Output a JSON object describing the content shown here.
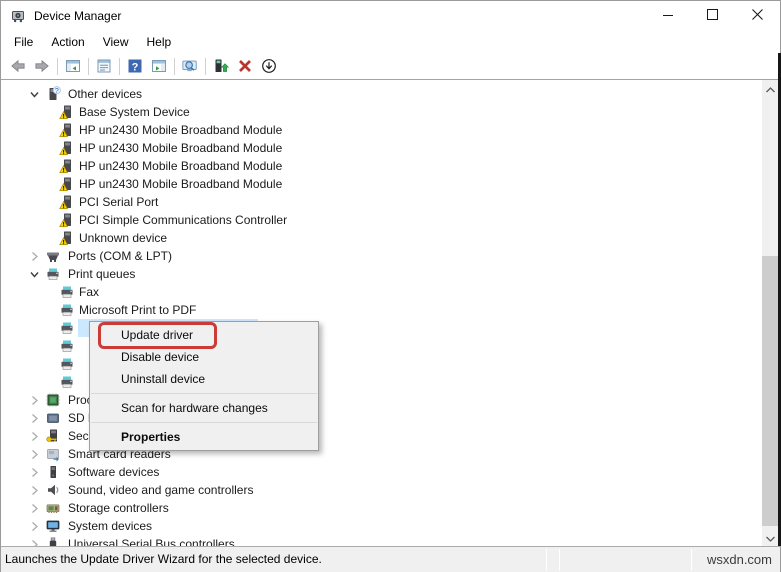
{
  "window": {
    "title": "Device Manager",
    "icon": "device-manager",
    "controls": [
      {
        "name": "minimize"
      },
      {
        "name": "maximize"
      },
      {
        "name": "close"
      }
    ]
  },
  "menu_bar": {
    "items": [
      {
        "label": "File"
      },
      {
        "label": "Action"
      },
      {
        "label": "View"
      },
      {
        "label": "Help"
      }
    ]
  },
  "toolbar": {
    "items": [
      {
        "icon": "back-arrow"
      },
      {
        "icon": "forward-arrow"
      },
      {
        "separator": true
      },
      {
        "icon": "console-tree"
      },
      {
        "separator": true
      },
      {
        "icon": "properties"
      },
      {
        "separator": true
      },
      {
        "icon": "help"
      },
      {
        "icon": "action-pane"
      },
      {
        "separator": true
      },
      {
        "icon": "scan-hardware"
      },
      {
        "separator": true
      },
      {
        "icon": "update-driver"
      },
      {
        "icon": "uninstall-device"
      },
      {
        "icon": "disable-device"
      }
    ]
  },
  "tree": {
    "items": [
      {
        "label": "Other devices",
        "icon": "other-devices",
        "level": 0,
        "chevron": "expanded"
      },
      {
        "label": "Base System Device",
        "icon": "warning-device",
        "level": 1
      },
      {
        "label": "HP un2430 Mobile Broadband Module",
        "icon": "warning-device",
        "level": 1
      },
      {
        "label": "HP un2430 Mobile Broadband Module",
        "icon": "warning-device",
        "level": 1
      },
      {
        "label": "HP un2430 Mobile Broadband Module",
        "icon": "warning-device",
        "level": 1
      },
      {
        "label": "HP un2430 Mobile Broadband Module",
        "icon": "warning-device",
        "level": 1
      },
      {
        "label": "PCI Serial Port",
        "icon": "warning-device",
        "level": 1
      },
      {
        "label": "PCI Simple Communications Controller",
        "icon": "warning-device",
        "level": 1
      },
      {
        "label": "Unknown device",
        "icon": "warning-device",
        "level": 1
      },
      {
        "label": "Ports (COM & LPT)",
        "icon": "ports",
        "level": 0,
        "chevron": "collapsed"
      },
      {
        "label": "Print queues",
        "icon": "printer",
        "level": 0,
        "chevron": "expanded"
      },
      {
        "label": "Fax",
        "icon": "printer",
        "level": 1
      },
      {
        "label": "Microsoft Print to PDF",
        "icon": "printer",
        "level": 1
      },
      {
        "label": "",
        "icon": "printer",
        "level": 1,
        "selected": true
      },
      {
        "label": "",
        "icon": "printer",
        "level": 1
      },
      {
        "label": "",
        "icon": "printer",
        "level": 1
      },
      {
        "label": "",
        "icon": "printer",
        "level": 1
      },
      {
        "label": "Processors",
        "icon": "processor",
        "level": 0,
        "chevron": "collapsed"
      },
      {
        "label": "SD host adapters",
        "icon": "sd-host",
        "level": 0,
        "chevron": "collapsed"
      },
      {
        "label": "Security devices",
        "icon": "security",
        "level": 0,
        "chevron": "collapsed"
      },
      {
        "label": "Smart card readers",
        "icon": "smart-card",
        "level": 0,
        "chevron": "collapsed"
      },
      {
        "label": "Software devices",
        "icon": "software",
        "level": 0,
        "chevron": "collapsed"
      },
      {
        "label": "Sound, video and game controllers",
        "icon": "sound",
        "level": 0,
        "chevron": "collapsed"
      },
      {
        "label": "Storage controllers",
        "icon": "storage",
        "level": 0,
        "chevron": "collapsed"
      },
      {
        "label": "System devices",
        "icon": "system",
        "level": 0,
        "chevron": "collapsed"
      },
      {
        "label": "Universal Serial Bus controllers",
        "icon": "usb",
        "level": 0,
        "chevron": "collapsed"
      }
    ]
  },
  "context_menu": {
    "items": [
      {
        "label": "Update driver",
        "annotated": true
      },
      {
        "label": "Disable device"
      },
      {
        "label": "Uninstall device",
        "separator_after": true
      },
      {
        "label": "Scan for hardware changes",
        "separator_after": true
      },
      {
        "label": "Properties",
        "bold": true
      }
    ]
  },
  "status_bar": {
    "message": "Launches the Update Driver Wizard for the selected device.",
    "watermark": "wsxdn.com"
  },
  "colors": {
    "selection": "#cce8ff",
    "annotation_red": "#cd3b38",
    "warning_yellow": "#fdd400",
    "menu_bg": "#f0f0f0",
    "help_blue": "#3e68b0",
    "uninstall_red": "#b8362e",
    "update_green": "#34a853"
  }
}
